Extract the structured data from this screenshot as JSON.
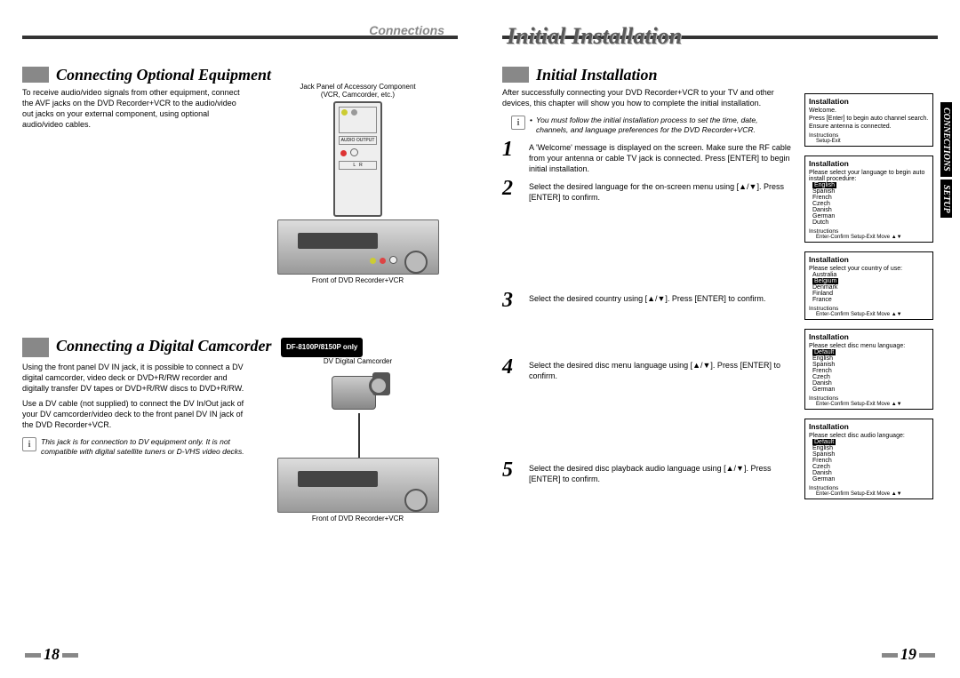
{
  "header": {
    "left_label": "Connections",
    "right_title": "Initial Installation"
  },
  "left_page": {
    "section1": {
      "title": "Connecting Optional Equipment",
      "body": "To receive audio/video signals from other equipment, connect the AVF jacks on the DVD Recorder+VCR to the audio/video out jacks on your external component, using optional audio/video cables.",
      "fig_caption_top": "Jack Panel of Accessory Component\n(VCR, Camcorder, etc.)",
      "fig_caption_bottom": "Front of DVD Recorder+VCR"
    },
    "section2": {
      "title": "Connecting a Digital Camcorder",
      "badge": "DF-8100P/8150P only",
      "body1": "Using the front panel DV IN jack, it is possible to connect a DV digital camcorder, video deck or DVD+R/RW recorder and digitally transfer DV tapes or DVD+R/RW discs to DVD+R/RW.",
      "body2": "Use a DV cable (not supplied) to connect the DV In/Out jack of your DV camcorder/video deck to the front panel DV IN jack of the DVD Recorder+VCR.",
      "note": "This jack is for connection to DV equipment only. It is not compatible with digital satellite tuners or D-VHS video decks.",
      "fig_caption_top": "DV Digital Camcorder",
      "fig_caption_bottom": "Front of DVD Recorder+VCR"
    },
    "page_num": "18"
  },
  "right_page": {
    "section": {
      "title": "Initial Installation",
      "intro": "After successfully connecting your DVD Recorder+VCR to your TV and other devices, this chapter will show you how to complete the initial installation.",
      "note": "You must follow the initial installation process to set the time, date, channels, and language preferences for the DVD Recorder+VCR.",
      "steps": [
        "A 'Welcome' message is displayed on the screen. Make sure the RF cable from your antenna or cable TV jack is connected. Press [ENTER] to begin initial installation.",
        "Select the desired language for the on-screen menu using [▲/▼]. Press [ENTER] to confirm.",
        "Select the desired country using [▲/▼]. Press [ENTER] to confirm.",
        "Select the desired disc menu language using [▲/▼]. Press [ENTER] to confirm.",
        "Select the desired disc playback audio language using [▲/▼]. Press [ENTER] to confirm."
      ]
    },
    "osd": [
      {
        "title": "Installation",
        "lines": [
          "Welcome.",
          "Press [Enter] to begin auto channel search.",
          "Ensure antenna is connected."
        ],
        "footer2": "Setup-Exit"
      },
      {
        "title": "Installation",
        "prompt": "Please select your language to begin auto install procedure:",
        "selected": "English",
        "items": [
          "Spanish",
          "French",
          "Czech",
          "Danish",
          "German",
          "Dutch"
        ]
      },
      {
        "title": "Installation",
        "prompt": "Please select your country of use:",
        "pre": "Australia",
        "selected": "Belgium",
        "items": [
          "Denmark",
          "Finland",
          "France"
        ]
      },
      {
        "title": "Installation",
        "prompt": "Please select disc menu language:",
        "selected": "Default",
        "items": [
          "English",
          "Spanish",
          "French",
          "Czech",
          "Danish",
          "German"
        ]
      },
      {
        "title": "Installation",
        "prompt": "Please select disc audio language:",
        "selected": "Default",
        "items": [
          "English",
          "Spanish",
          "French",
          "Czech",
          "Danish",
          "German"
        ]
      }
    ],
    "osd_footer_instr": "Instructions",
    "osd_footer_hints": "Enter-Confirm   Setup-Exit   Move ▲▼",
    "tabs": {
      "a": "CONNECTIONS",
      "b": "SETUP"
    },
    "page_num": "19"
  }
}
